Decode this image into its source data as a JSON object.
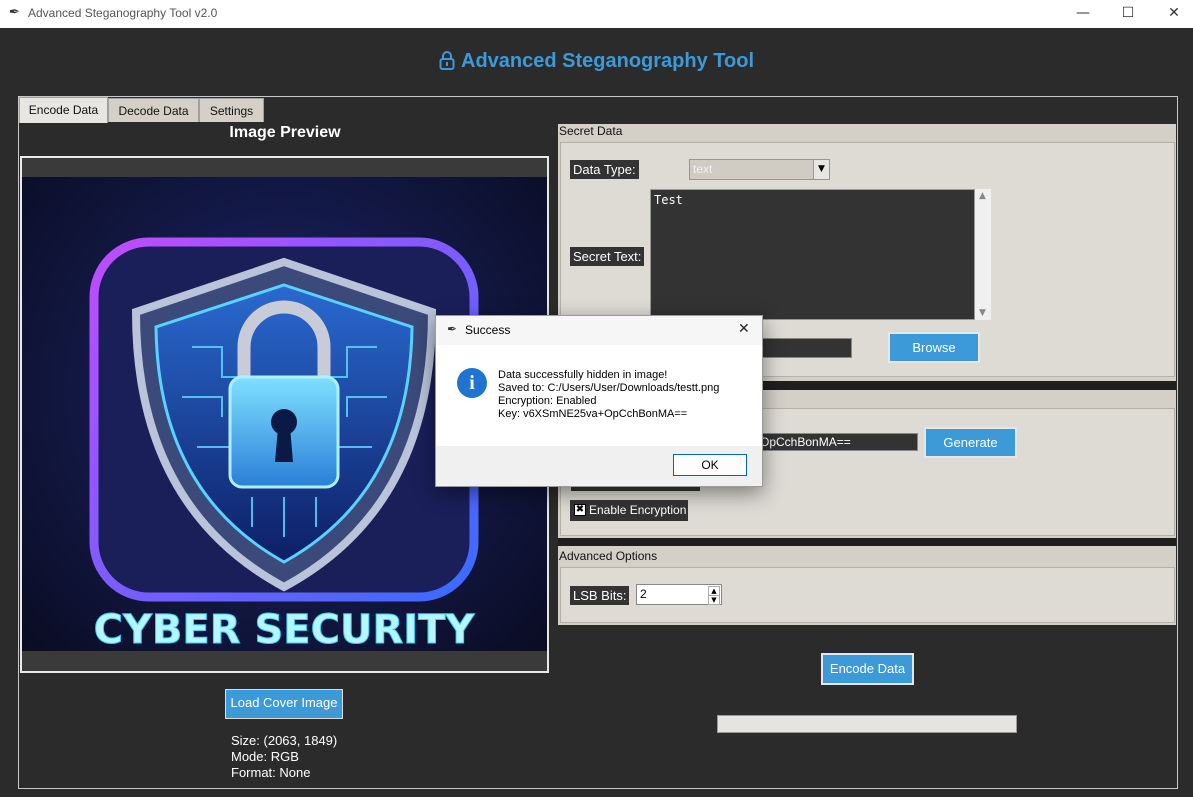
{
  "window": {
    "title": "Advanced Steganography Tool v2.0",
    "minimize": "—",
    "maximize": "☐",
    "close": "✕"
  },
  "header": {
    "title": "Advanced Steganography Tool"
  },
  "tabs": [
    "Encode Data",
    "Decode Data",
    "Settings"
  ],
  "preview": {
    "title": "Image Preview",
    "image_text": "CYBER SECURITY",
    "load_button": "Load Cover Image",
    "size": "Size: (2063, 1849)",
    "mode": "Mode: RGB",
    "format": "Format: None"
  },
  "secret": {
    "group_label": "Secret Data",
    "data_type_label": "Data Type:",
    "data_type_value": "text",
    "secret_text_label": "Secret Text:",
    "secret_text_value": "Test",
    "browse_button": "Browse"
  },
  "encryption": {
    "key_value": "OpCchBonMA==",
    "generate_button": "Generate",
    "enable_label": "Enable Encryption"
  },
  "advanced": {
    "group_label": "Advanced Options",
    "lsb_label": "LSB Bits:",
    "lsb_value": "2"
  },
  "encode_button": "Encode Data",
  "dialog": {
    "title": "Success",
    "line1": "Data successfully hidden in image!",
    "line2": "Saved to: C:/Users/User/Downloads/testt.png",
    "line3": "Encryption: Enabled",
    "line4": "Key: v6XSmNE25va+OpCchBonMA==",
    "ok": "OK"
  },
  "colors": {
    "accent": "#3c9ad8",
    "background": "#2b2b2b",
    "panel": "#d4d0c8"
  }
}
